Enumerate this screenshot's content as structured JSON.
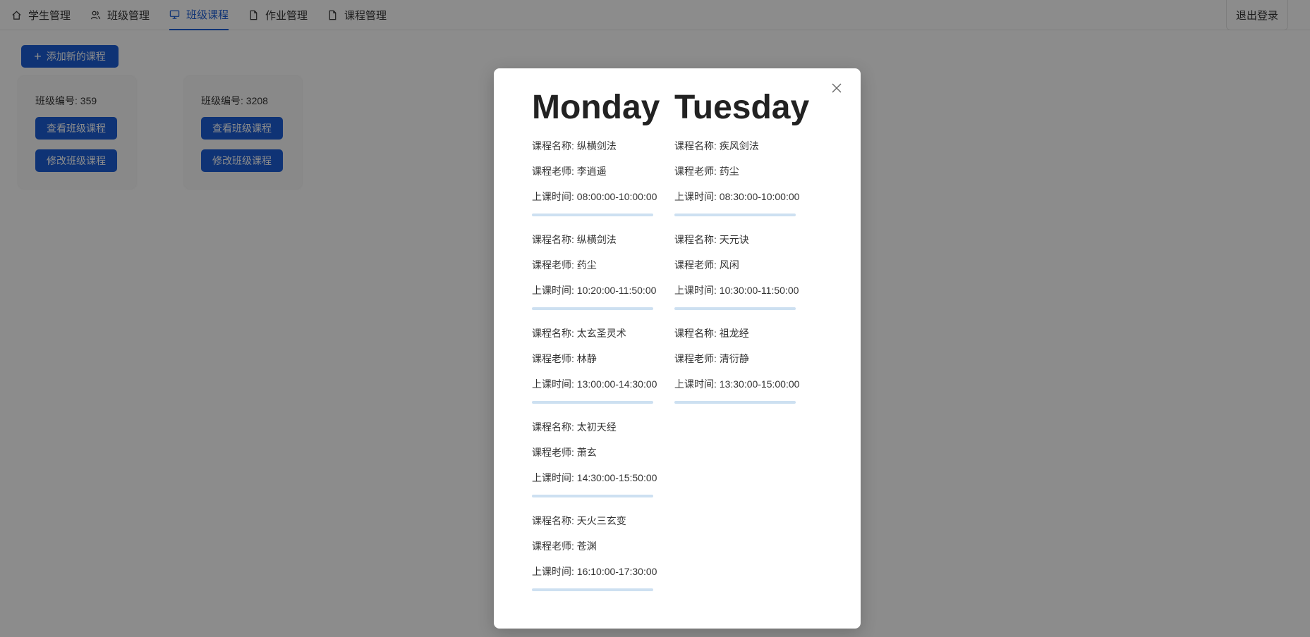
{
  "nav": {
    "items": [
      {
        "label": "学生管理",
        "icon": "home-icon"
      },
      {
        "label": "班级管理",
        "icon": "user-group-icon"
      },
      {
        "label": "班级课程",
        "icon": "desktop-icon",
        "active": true
      },
      {
        "label": "作业管理",
        "icon": "file-icon"
      },
      {
        "label": "课程管理",
        "icon": "file-icon"
      }
    ],
    "logout_label": "退出登录"
  },
  "main": {
    "add_course_label": "添加新的课程",
    "classes": [
      {
        "id_text": "班级编号: 359",
        "view_label": "查看班级课程",
        "edit_label": "修改班级课程"
      },
      {
        "id_text": "班级编号: 3208",
        "view_label": "查看班级课程",
        "edit_label": "修改班级课程"
      }
    ]
  },
  "modal": {
    "close_icon": "close-icon",
    "days": [
      {
        "title": "Monday",
        "courses": [
          {
            "name": "课程名称: 纵横剑法",
            "teacher": "课程老师: 李逍遥",
            "time": "上课时间: 08:00:00-10:00:00"
          },
          {
            "name": "课程名称: 纵横剑法",
            "teacher": "课程老师: 药尘",
            "time": "上课时间: 10:20:00-11:50:00"
          },
          {
            "name": "课程名称: 太玄圣灵术",
            "teacher": "课程老师: 林静",
            "time": "上课时间: 13:00:00-14:30:00"
          },
          {
            "name": "课程名称: 太初天经",
            "teacher": "课程老师: 萧玄",
            "time": "上课时间: 14:30:00-15:50:00"
          },
          {
            "name": "课程名称: 天火三玄变",
            "teacher": "课程老师: 苍渊",
            "time": "上课时间: 16:10:00-17:30:00"
          }
        ]
      },
      {
        "title": "Tuesday",
        "courses": [
          {
            "name": "课程名称: 疾风剑法",
            "teacher": "课程老师: 药尘",
            "time": "上课时间: 08:30:00-10:00:00"
          },
          {
            "name": "课程名称: 天元诀",
            "teacher": "课程老师: 风闲",
            "time": "上课时间: 10:30:00-11:50:00"
          },
          {
            "name": "课程名称: 祖龙经",
            "teacher": "课程老师: 清衍静",
            "time": "上课时间: 13:30:00-15:00:00"
          }
        ]
      }
    ]
  },
  "colors": {
    "accent": "#1c5ed6",
    "separator": "#cde0f1",
    "overlay": "rgba(0,0,0,0.45)"
  }
}
